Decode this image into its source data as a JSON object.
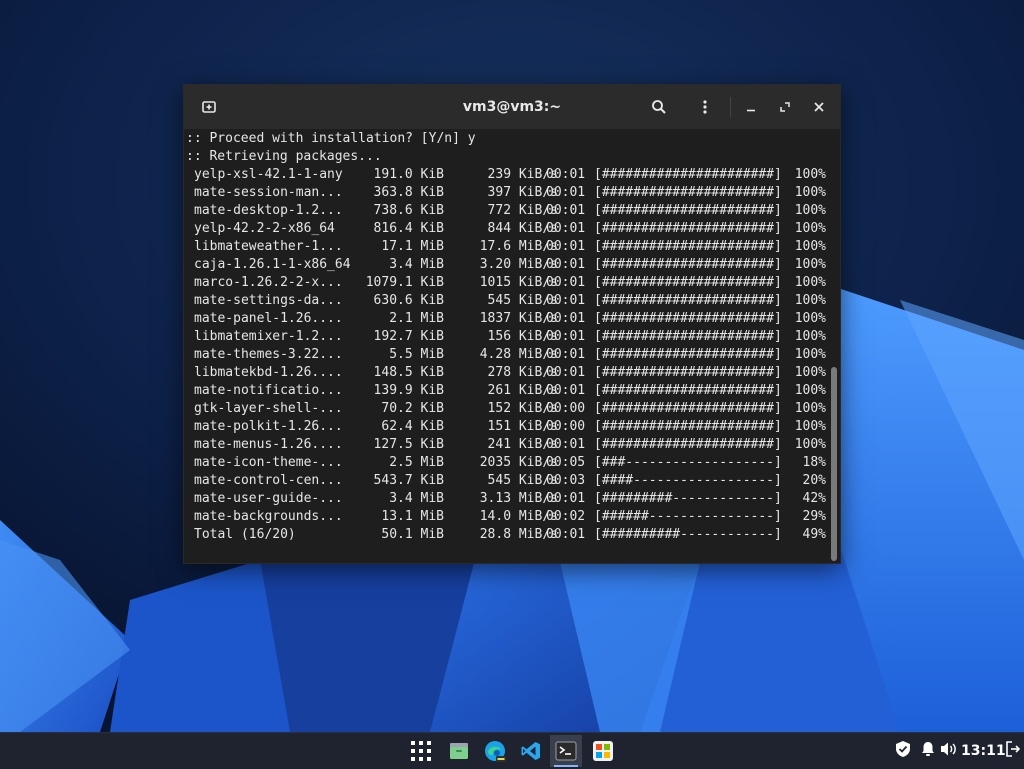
{
  "window": {
    "title": "vm3@vm3:~"
  },
  "terminal": {
    "prompt_line": ":: Proceed with installation? [Y/n] y",
    "status_line": ":: Retrieving packages...",
    "rows": [
      {
        "name": "yelp-xsl-42.1-1-any",
        "size": "191.0 KiB",
        "rate": "239 KiB/s",
        "time": "00:01",
        "bar": "[######################]",
        "pct": "100%"
      },
      {
        "name": "mate-session-man...",
        "size": "363.8 KiB",
        "rate": "397 KiB/s",
        "time": "00:01",
        "bar": "[######################]",
        "pct": "100%"
      },
      {
        "name": "mate-desktop-1.2...",
        "size": "738.6 KiB",
        "rate": "772 KiB/s",
        "time": "00:01",
        "bar": "[######################]",
        "pct": "100%"
      },
      {
        "name": "yelp-42.2-2-x86_64",
        "size": "816.4 KiB",
        "rate": "844 KiB/s",
        "time": "00:01",
        "bar": "[######################]",
        "pct": "100%"
      },
      {
        "name": "libmateweather-1...",
        "size": "17.1 MiB",
        "rate": "17.6 MiB/s",
        "time": "00:01",
        "bar": "[######################]",
        "pct": "100%"
      },
      {
        "name": "caja-1.26.1-1-x86_64",
        "size": "3.4 MiB",
        "rate": "3.20 MiB/s",
        "time": "00:01",
        "bar": "[######################]",
        "pct": "100%"
      },
      {
        "name": "marco-1.26.2-2-x...",
        "size": "1079.1 KiB",
        "rate": "1015 KiB/s",
        "time": "00:01",
        "bar": "[######################]",
        "pct": "100%"
      },
      {
        "name": "mate-settings-da...",
        "size": "630.6 KiB",
        "rate": "545 KiB/s",
        "time": "00:01",
        "bar": "[######################]",
        "pct": "100%"
      },
      {
        "name": "mate-panel-1.26....",
        "size": "2.1 MiB",
        "rate": "1837 KiB/s",
        "time": "00:01",
        "bar": "[######################]",
        "pct": "100%"
      },
      {
        "name": "libmatemixer-1.2...",
        "size": "192.7 KiB",
        "rate": "156 KiB/s",
        "time": "00:01",
        "bar": "[######################]",
        "pct": "100%"
      },
      {
        "name": "mate-themes-3.22...",
        "size": "5.5 MiB",
        "rate": "4.28 MiB/s",
        "time": "00:01",
        "bar": "[######################]",
        "pct": "100%"
      },
      {
        "name": "libmatekbd-1.26....",
        "size": "148.5 KiB",
        "rate": "278 KiB/s",
        "time": "00:01",
        "bar": "[######################]",
        "pct": "100%"
      },
      {
        "name": "mate-notificatio...",
        "size": "139.9 KiB",
        "rate": "261 KiB/s",
        "time": "00:01",
        "bar": "[######################]",
        "pct": "100%"
      },
      {
        "name": "gtk-layer-shell-...",
        "size": "70.2 KiB",
        "rate": "152 KiB/s",
        "time": "00:00",
        "bar": "[######################]",
        "pct": "100%"
      },
      {
        "name": "mate-polkit-1.26...",
        "size": "62.4 KiB",
        "rate": "151 KiB/s",
        "time": "00:00",
        "bar": "[######################]",
        "pct": "100%"
      },
      {
        "name": "mate-menus-1.26....",
        "size": "127.5 KiB",
        "rate": "241 KiB/s",
        "time": "00:01",
        "bar": "[######################]",
        "pct": "100%"
      },
      {
        "name": "mate-icon-theme-...",
        "size": "2.5 MiB",
        "rate": "2035 KiB/s",
        "time": "00:05",
        "bar": "[###-------------------]",
        "pct": "18%"
      },
      {
        "name": "mate-control-cen...",
        "size": "543.7 KiB",
        "rate": "545 KiB/s",
        "time": "00:03",
        "bar": "[####------------------]",
        "pct": "20%"
      },
      {
        "name": "mate-user-guide-...",
        "size": "3.4 MiB",
        "rate": "3.13 MiB/s",
        "time": "00:01",
        "bar": "[#########-------------]",
        "pct": "42%"
      },
      {
        "name": "mate-backgrounds...",
        "size": "13.1 MiB",
        "rate": "14.0 MiB/s",
        "time": "00:02",
        "bar": "[######----------------]",
        "pct": "29%"
      },
      {
        "name": "Total (16/20)",
        "size": "50.1 MiB",
        "rate": "28.8 MiB/s",
        "time": "00:01",
        "bar": "[##########------------]",
        "pct": "49%"
      }
    ]
  },
  "taskbar": {
    "apps": [
      {
        "icon": "app-grid-icon"
      },
      {
        "icon": "file-manager-icon"
      },
      {
        "icon": "edge-dev-icon"
      },
      {
        "icon": "vscode-icon"
      },
      {
        "icon": "terminal-icon"
      },
      {
        "icon": "software-store-icon"
      }
    ],
    "clock": "13:11"
  },
  "colors": {
    "accent": "#8ab4f8",
    "terminal_bg": "#1e1e1e",
    "titlebar_bg": "#2b2b2b",
    "taskbar_bg": "#1f2330"
  }
}
